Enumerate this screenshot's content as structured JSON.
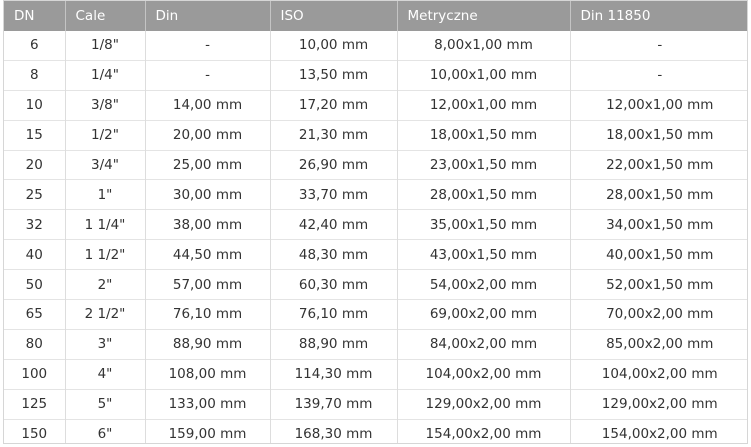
{
  "table": {
    "headers": [
      "DN",
      "Cale",
      "Din",
      "ISO",
      "Metryczne",
      "Din 11850"
    ],
    "rows": [
      [
        "6",
        "1/8\"",
        "-",
        "10,00 mm",
        "8,00x1,00 mm",
        "-"
      ],
      [
        "8",
        "1/4\"",
        "-",
        "13,50 mm",
        "10,00x1,00 mm",
        "-"
      ],
      [
        "10",
        "3/8\"",
        "14,00 mm",
        "17,20 mm",
        "12,00x1,00 mm",
        "12,00x1,00 mm"
      ],
      [
        "15",
        "1/2\"",
        "20,00 mm",
        "21,30 mm",
        "18,00x1,50 mm",
        "18,00x1,50 mm"
      ],
      [
        "20",
        "3/4\"",
        "25,00 mm",
        "26,90 mm",
        "23,00x1,50 mm",
        "22,00x1,50 mm"
      ],
      [
        "25",
        "1\"",
        "30,00 mm",
        "33,70 mm",
        "28,00x1,50 mm",
        "28,00x1,50 mm"
      ],
      [
        "32",
        "1 1/4\"",
        "38,00 mm",
        "42,40 mm",
        "35,00x1,50 mm",
        "34,00x1,50 mm"
      ],
      [
        "40",
        "1 1/2\"",
        "44,50 mm",
        "48,30 mm",
        "43,00x1,50 mm",
        "40,00x1,50 mm"
      ],
      [
        "50",
        "2\"",
        "57,00 mm",
        "60,30 mm",
        "54,00x2,00 mm",
        "52,00x1,50 mm"
      ],
      [
        "65",
        "2 1/2\"",
        "76,10 mm",
        "76,10 mm",
        "69,00x2,00 mm",
        "70,00x2,00 mm"
      ],
      [
        "80",
        "3\"",
        "88,90 mm",
        "88,90 mm",
        "84,00x2,00 mm",
        "85,00x2,00 mm"
      ],
      [
        "100",
        "4\"",
        "108,00 mm",
        "114,30 mm",
        "104,00x2,00 mm",
        "104,00x2,00 mm"
      ],
      [
        "125",
        "5\"",
        "133,00 mm",
        "139,70 mm",
        "129,00x2,00 mm",
        "129,00x2,00 mm"
      ],
      [
        "150",
        "6\"",
        "159,00 mm",
        "168,30 mm",
        "154,00x2,00 mm",
        "154,00x2,00 mm"
      ]
    ]
  },
  "colors": {
    "header_bg": "#9a9a9a",
    "header_text": "#ffffff",
    "cell_text": "#333333",
    "grid_line": "#dddddd"
  }
}
